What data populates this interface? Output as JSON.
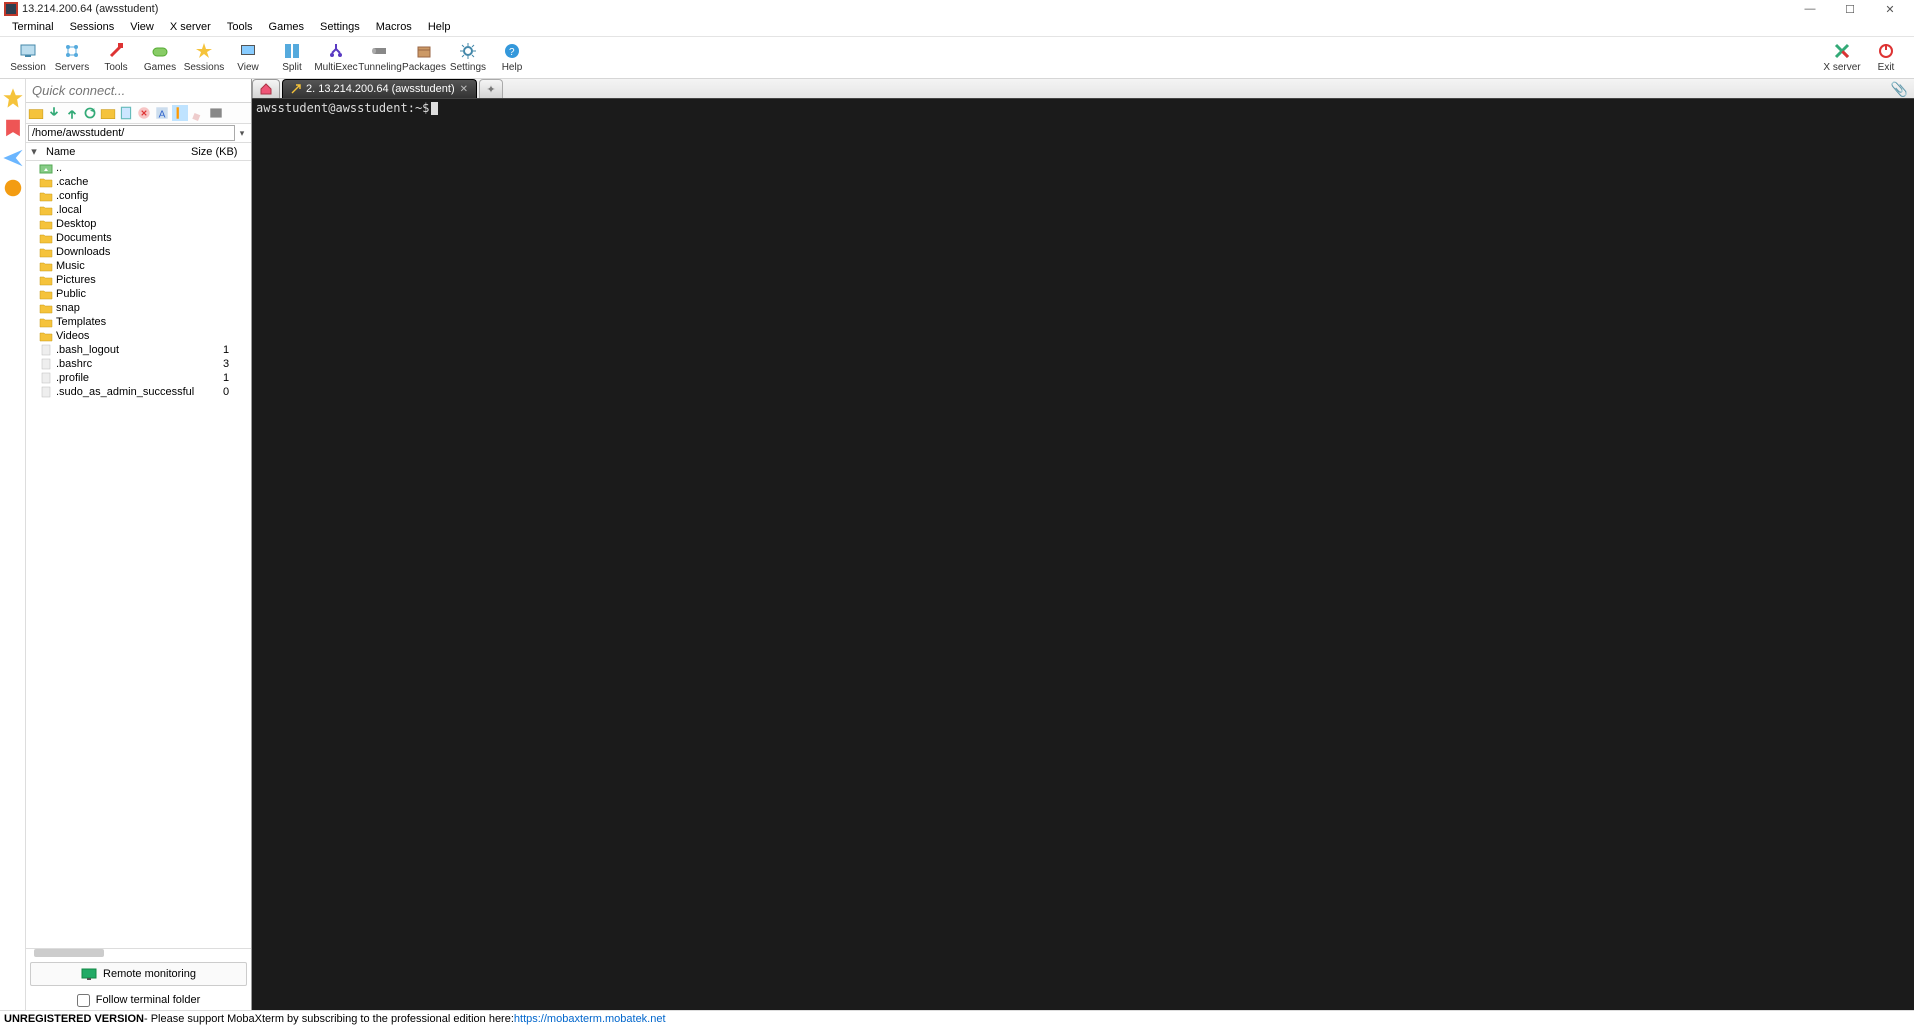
{
  "window": {
    "title": "13.214.200.64 (awsstudent)"
  },
  "win_buttons": {
    "min": "—",
    "max": "☐",
    "close": "✕"
  },
  "menu": [
    "Terminal",
    "Sessions",
    "View",
    "X server",
    "Tools",
    "Games",
    "Settings",
    "Macros",
    "Help"
  ],
  "toolbar_left": [
    {
      "name": "session",
      "label": "Session"
    },
    {
      "name": "servers",
      "label": "Servers"
    },
    {
      "name": "tools",
      "label": "Tools"
    },
    {
      "name": "games",
      "label": "Games"
    },
    {
      "name": "sessions",
      "label": "Sessions"
    },
    {
      "name": "view",
      "label": "View"
    },
    {
      "name": "split",
      "label": "Split"
    },
    {
      "name": "multiexec",
      "label": "MultiExec"
    },
    {
      "name": "tunneling",
      "label": "Tunneling"
    },
    {
      "name": "packages",
      "label": "Packages"
    },
    {
      "name": "settings",
      "label": "Settings"
    },
    {
      "name": "help",
      "label": "Help"
    }
  ],
  "toolbar_right": [
    {
      "name": "xserver",
      "label": "X server"
    },
    {
      "name": "exit",
      "label": "Exit"
    }
  ],
  "quick_connect": {
    "placeholder": "Quick connect..."
  },
  "sftp": {
    "path": "/home/awsstudent/",
    "columns": {
      "name": "Name",
      "size": "Size (KB)"
    },
    "items": [
      {
        "type": "up",
        "name": "..",
        "size": ""
      },
      {
        "type": "folder",
        "name": ".cache",
        "size": ""
      },
      {
        "type": "folder",
        "name": ".config",
        "size": ""
      },
      {
        "type": "folder",
        "name": ".local",
        "size": ""
      },
      {
        "type": "folder",
        "name": "Desktop",
        "size": ""
      },
      {
        "type": "folder",
        "name": "Documents",
        "size": ""
      },
      {
        "type": "folder",
        "name": "Downloads",
        "size": ""
      },
      {
        "type": "folder",
        "name": "Music",
        "size": ""
      },
      {
        "type": "folder",
        "name": "Pictures",
        "size": ""
      },
      {
        "type": "folder",
        "name": "Public",
        "size": ""
      },
      {
        "type": "folder",
        "name": "snap",
        "size": ""
      },
      {
        "type": "folder",
        "name": "Templates",
        "size": ""
      },
      {
        "type": "folder",
        "name": "Videos",
        "size": ""
      },
      {
        "type": "file",
        "name": ".bash_logout",
        "size": "1"
      },
      {
        "type": "file",
        "name": ".bashrc",
        "size": "3"
      },
      {
        "type": "file",
        "name": ".profile",
        "size": "1"
      },
      {
        "type": "file",
        "name": ".sudo_as_admin_successful",
        "size": "0"
      }
    ]
  },
  "remote_monitoring_label": "Remote monitoring",
  "follow_terminal_label": "Follow terminal folder",
  "tabs": {
    "active": {
      "label": "2. 13.214.200.64 (awsstudent)"
    }
  },
  "terminal": {
    "prompt": "awsstudent@awsstudent:~$"
  },
  "statusbar": {
    "bold": "UNREGISTERED VERSION",
    "text": " - Please support MobaXterm by subscribing to the professional edition here: ",
    "link": "https://mobaxterm.mobatek.net"
  }
}
